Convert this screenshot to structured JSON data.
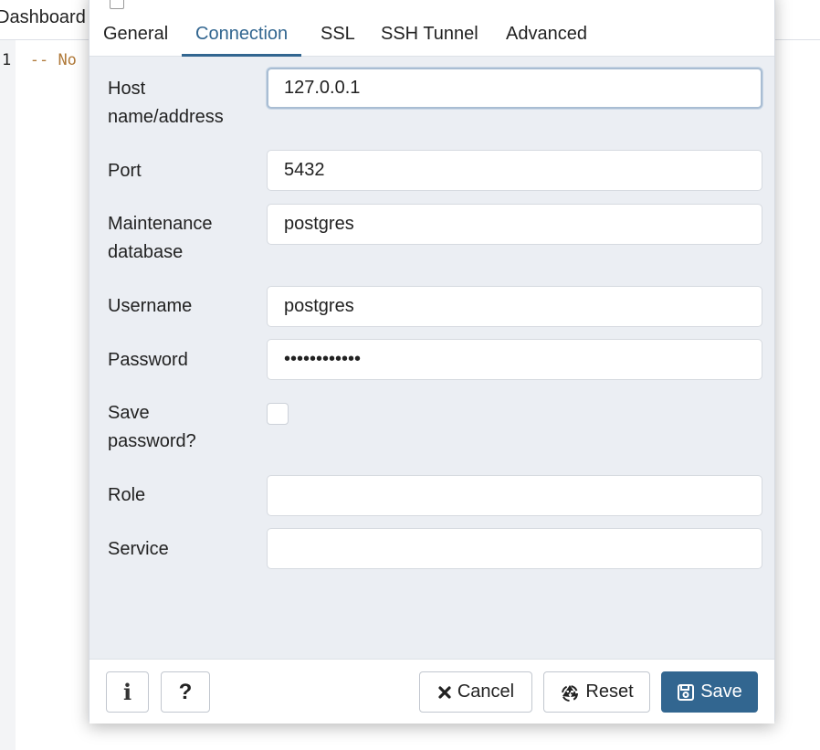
{
  "background": {
    "tab_label": "Dashboard",
    "editor_line_number": "1",
    "editor_line_text": "-- No"
  },
  "dialog": {
    "tabs": [
      {
        "label": "General"
      },
      {
        "label": "Connection",
        "active": true
      },
      {
        "label": "SSL"
      },
      {
        "label": "SSH Tunnel"
      },
      {
        "label": "Advanced"
      }
    ],
    "fields": {
      "host": {
        "label": "Host name/address",
        "value": "127.0.0.1"
      },
      "port": {
        "label": "Port",
        "value": "5432"
      },
      "maintenance_db": {
        "label": "Maintenance database",
        "value": "postgres"
      },
      "username": {
        "label": "Username",
        "value": "postgres"
      },
      "password": {
        "label": "Password",
        "value": "••••••••••••"
      },
      "save_password": {
        "label": "Save password?",
        "checked": false
      },
      "role": {
        "label": "Role",
        "value": ""
      },
      "service": {
        "label": "Service",
        "value": ""
      }
    },
    "footer": {
      "info_label": "i",
      "help_label": "?",
      "cancel_label": "Cancel",
      "reset_label": "Reset",
      "save_label": "Save"
    }
  },
  "colors": {
    "accent": "#326690",
    "dialog_bg": "#ebeef3"
  },
  "icons": {
    "cancel": "close-icon",
    "reset": "recycle-icon",
    "save": "floppy-disk-icon",
    "info": "info-icon",
    "help": "question-icon"
  }
}
